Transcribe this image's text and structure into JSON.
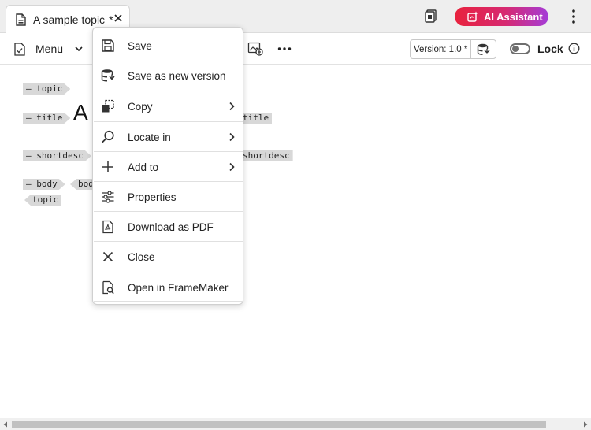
{
  "tab": {
    "title": "A sample topic",
    "dirty_mark": "*"
  },
  "header": {
    "ai_button_label": "AI Assistant"
  },
  "toolbar": {
    "menu_label": "Menu",
    "version_label": "Version: 1.0 *",
    "lock_label": "Lock"
  },
  "editor": {
    "topic_open": "topic",
    "title_open": "title",
    "title_text_visible": "A",
    "title_close": "title",
    "shortdesc_open": "shortdesc",
    "shortdesc_close": "shortdesc",
    "body_open": "body",
    "body_partial": "bod",
    "topic_close": "topic"
  },
  "context_menu": {
    "items": [
      {
        "label": "Save",
        "icon": "floppy-disk-icon"
      },
      {
        "label": "Save as new version",
        "icon": "database-save-icon"
      },
      {
        "label": "Copy",
        "icon": "copy-icon",
        "submenu": true
      },
      {
        "label": "Locate in",
        "icon": "search-icon",
        "submenu": true
      },
      {
        "label": "Add to",
        "icon": "plus-icon",
        "submenu": true
      },
      {
        "label": "Properties",
        "icon": "sliders-icon"
      },
      {
        "label": "Download as PDF",
        "icon": "pdf-file-icon"
      },
      {
        "label": "Close",
        "icon": "close-icon"
      },
      {
        "label": "Open in FrameMaker",
        "icon": "file-search-icon"
      }
    ]
  },
  "colors": {
    "ai_gradient_start": "#e8223d",
    "ai_gradient_end": "#a43cd8",
    "tag_bg": "#d8d8d8"
  }
}
